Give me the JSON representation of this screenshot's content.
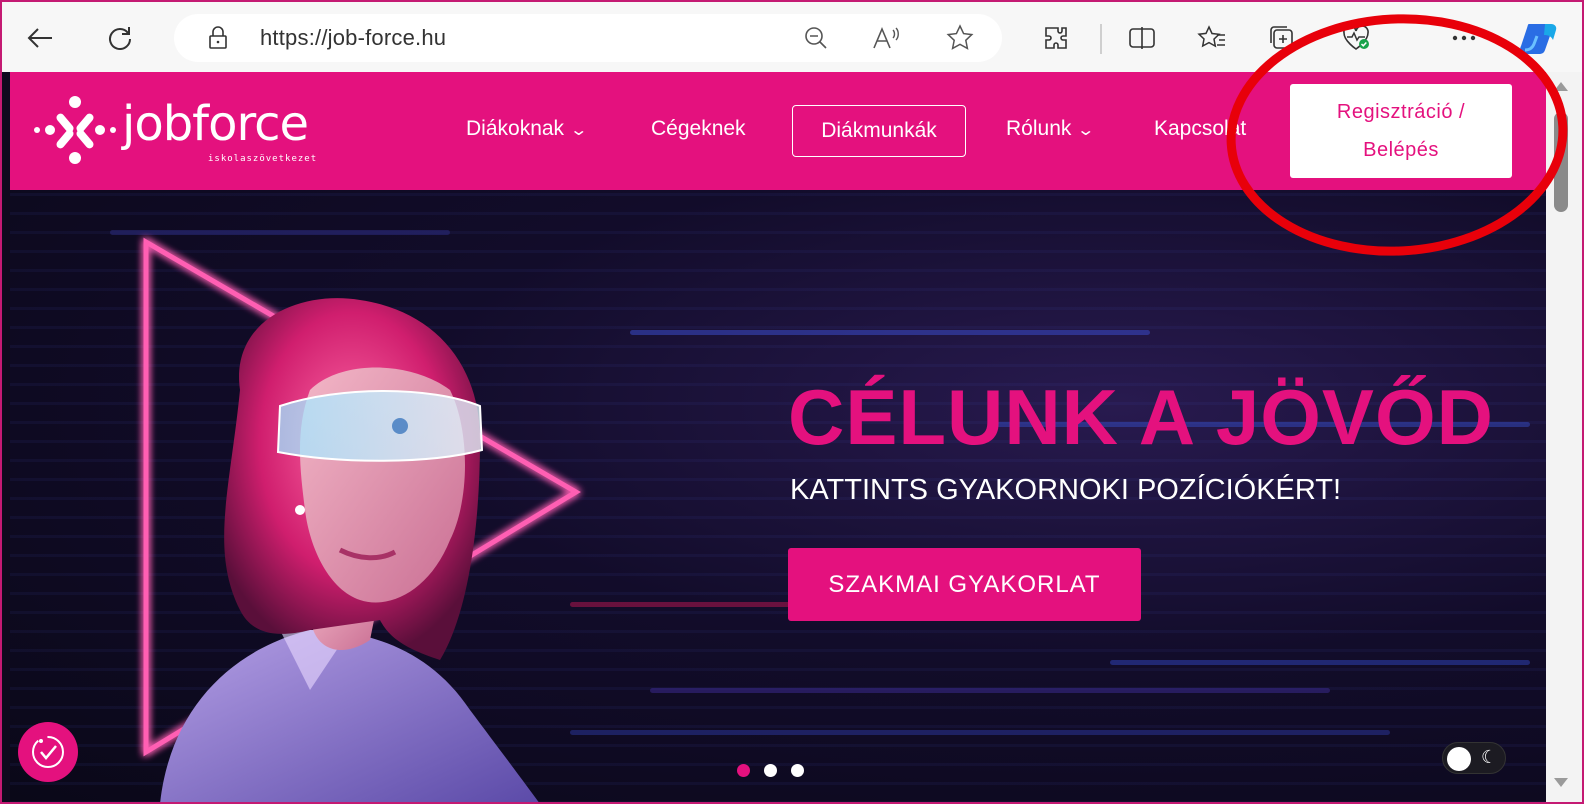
{
  "browser": {
    "url": "https://job-force.hu",
    "icons": [
      "back-arrow-icon",
      "refresh-icon",
      "lock-icon",
      "zoom-out-icon",
      "read-aloud-icon",
      "favorite-star-icon",
      "extensions-icon",
      "split-screen-icon",
      "favorites-icon",
      "collections-icon",
      "browser-essentials-icon",
      "more-icon",
      "copilot-icon"
    ]
  },
  "site": {
    "logo": {
      "word": "jobforce",
      "sub": "iskolaszövetkezet"
    },
    "nav": {
      "diakoknak": "Diákoknak",
      "cegeknek": "Cégeknek",
      "diakmunkak": "Diákmunkák",
      "rolunk": "Rólunk",
      "kapcsolat": "Kapcsolat"
    },
    "register": {
      "line1": "Regisztráció /",
      "line2": "Belépés"
    },
    "hero": {
      "title": "CÉLUNK A JÖVŐD",
      "subtitle": "KATTINTS GYAKORNOKI POZÍCIÓKÉRT!",
      "cta": "SZAKMAI GYAKORLAT"
    }
  },
  "colors": {
    "brand": "#e4117e",
    "annotation": "#e8000a",
    "hero_bg": "#120c2a"
  },
  "carousel": {
    "slide_count": 3,
    "active_index": 0
  }
}
